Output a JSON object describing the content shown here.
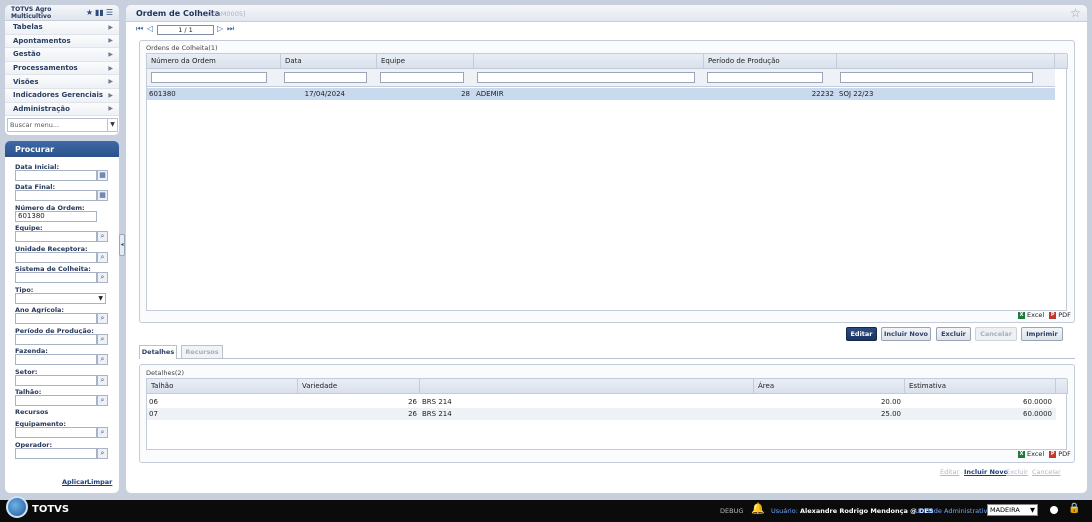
{
  "sidebar": {
    "title": "TOTVS Agro Multicultivo",
    "menu": [
      "Tabelas",
      "Apontamentos",
      "Gestão",
      "Processamentos",
      "Visões",
      "Indicadores Gerenciais",
      "Administração"
    ],
    "search_placeholder": "Buscar menu..."
  },
  "procurar": {
    "title": "Procurar",
    "fields": {
      "data_inicial": "Data Inicial:",
      "data_final": "Data Final:",
      "numero_ordem": "Número da Ordem:",
      "numero_ordem_value": "601380",
      "equipe": "Equipe:",
      "unidade_receptora": "Unidade Receptora:",
      "sistema_colheita": "Sistema de Colheita:",
      "tipo": "Tipo:",
      "ano_agricola": "Ano Agrícola:",
      "periodo_producao": "Período de Produção:",
      "fazenda": "Fazenda:",
      "setor": "Setor:",
      "talhao": "Talhão:",
      "recursos": "Recursos",
      "equipamento": "Equipamento:",
      "operador": "Operador:"
    },
    "apply": "Aplicar",
    "clear": "Limpar"
  },
  "main": {
    "title": "Ordem de Colheita",
    "code": "[COLM0005]",
    "pager": "1 / 1",
    "orders_caption": "Ordens de Colheita(1)",
    "orders_columns": [
      "Número da Ordem",
      "Data",
      "Equipe",
      "",
      "Período de Produção",
      ""
    ],
    "orders_rows": [
      {
        "numero": "601380",
        "data": "17/04/2024",
        "equipe_cod": "28",
        "equipe_nome": "ADEMIR",
        "periodo_cod": "22232",
        "periodo_nome": "SOJ 22/23"
      }
    ],
    "excel": "Excel",
    "pdf": "PDF",
    "actions": [
      "Editar",
      "Incluir Novo",
      "Excluir",
      "Cancelar",
      "Imprimir"
    ],
    "tabs": [
      "Detalhes",
      "Recursos"
    ],
    "details_caption": "Detalhes(2)",
    "details_columns": [
      "Talhão",
      "Variedade",
      "",
      "Área",
      "Estimativa"
    ],
    "details_rows": [
      {
        "talhao": "06",
        "var_cod": "26",
        "var_nome": "BRS 214",
        "area": "20.00",
        "estimativa": "60.0000"
      },
      {
        "talhao": "07",
        "var_cod": "26",
        "var_nome": "BRS 214",
        "area": "25.00",
        "estimativa": "60.0000"
      }
    ],
    "detail_links": [
      "Editar",
      "Incluir Novo",
      "Excluir",
      "Cancelar"
    ]
  },
  "footer": {
    "brand": "TOTVS",
    "debug": "DEBUG",
    "user_label": "Usuário:",
    "user": "Alexandre Rodrigo Mendonça @ DES",
    "unit_label": "Unidade Administrativa:",
    "unit_value": "MADEIRA"
  }
}
